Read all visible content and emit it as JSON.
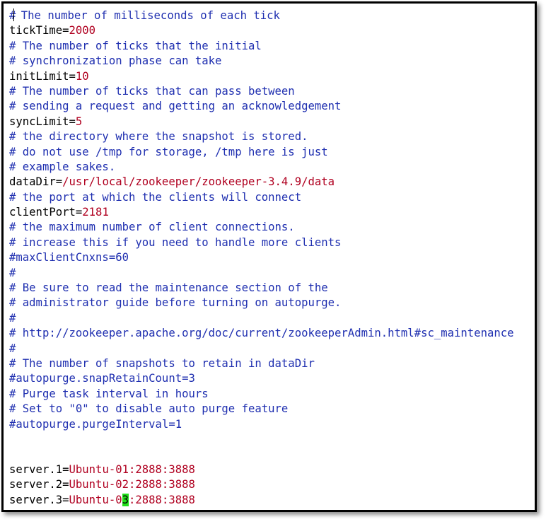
{
  "editor": {
    "lines": [
      {
        "type": "comment",
        "text": "# The number of milliseconds of each tick",
        "has_text_cursor": true
      },
      {
        "type": "kv",
        "key": "tickTime=",
        "value": "2000"
      },
      {
        "type": "comment",
        "text": "# The number of ticks that the initial"
      },
      {
        "type": "comment",
        "text": "# synchronization phase can take"
      },
      {
        "type": "kv",
        "key": "initLimit=",
        "value": "10"
      },
      {
        "type": "comment",
        "text": "# The number of ticks that can pass between"
      },
      {
        "type": "comment",
        "text": "# sending a request and getting an acknowledgement"
      },
      {
        "type": "kv",
        "key": "syncLimit=",
        "value": "5"
      },
      {
        "type": "comment",
        "text": "# the directory where the snapshot is stored."
      },
      {
        "type": "comment",
        "text": "# do not use /tmp for storage, /tmp here is just"
      },
      {
        "type": "comment",
        "text": "# example sakes."
      },
      {
        "type": "kv",
        "key": "dataDir=",
        "value": "/usr/local/zookeeper/zookeeper-3.4.9/data"
      },
      {
        "type": "comment",
        "text": "# the port at which the clients will connect"
      },
      {
        "type": "kv",
        "key": "clientPort=",
        "value": "2181"
      },
      {
        "type": "comment",
        "text": "# the maximum number of client connections."
      },
      {
        "type": "comment",
        "text": "# increase this if you need to handle more clients"
      },
      {
        "type": "comment",
        "text": "#maxClientCnxns=60"
      },
      {
        "type": "comment",
        "text": "#"
      },
      {
        "type": "comment",
        "text": "# Be sure to read the maintenance section of the"
      },
      {
        "type": "comment",
        "text": "# administrator guide before turning on autopurge."
      },
      {
        "type": "comment",
        "text": "#"
      },
      {
        "type": "comment",
        "text": "# http://zookeeper.apache.org/doc/current/zookeeperAdmin.html#sc_maintenance"
      },
      {
        "type": "comment",
        "text": "#"
      },
      {
        "type": "comment",
        "text": "# The number of snapshots to retain in dataDir"
      },
      {
        "type": "comment",
        "text": "#autopurge.snapRetainCount=3"
      },
      {
        "type": "comment",
        "text": "# Purge task interval in hours"
      },
      {
        "type": "comment",
        "text": "# Set to \"0\" to disable auto purge feature"
      },
      {
        "type": "comment",
        "text": "#autopurge.purgeInterval=1"
      },
      {
        "type": "blank",
        "text": ""
      },
      {
        "type": "blank",
        "text": ""
      },
      {
        "type": "kv",
        "key": "server.1=",
        "value": "Ubuntu-01:2888:3888"
      },
      {
        "type": "kv",
        "key": "server.2=",
        "value": "Ubuntu-02:2888:3888"
      },
      {
        "type": "kv",
        "key": "server.3=",
        "value": "Ubuntu-0",
        "cursor_char": "3",
        "value_after": ":2888:3888"
      }
    ]
  },
  "colors": {
    "comment": "#1f2fb0",
    "key": "#000000",
    "value": "#b00020",
    "cursor_highlight": "#22e01a"
  }
}
